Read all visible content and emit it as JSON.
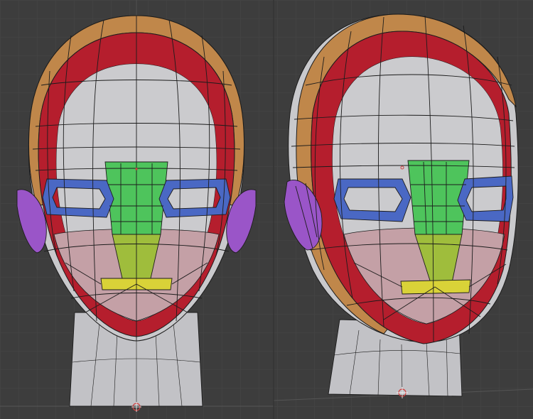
{
  "scene": {
    "views": [
      {
        "name": "front-view"
      },
      {
        "name": "three-quarter-view"
      }
    ],
    "colors": {
      "background": "#3d3d3d",
      "grid": "#4a4a4a",
      "grid_axis": "#5a5a5a",
      "mesh_base": "#c9c9cc",
      "mesh_shade": "#aeaeb2",
      "forehead_band_orange": "#c0874a",
      "face_loop_red": "#b51e2d",
      "eye_loop_blue": "#4a68c4",
      "nose_green": "#4ec45c",
      "nose_tip_yellowgreen": "#9fbd3c",
      "mouth_yellow": "#d9d238",
      "cheek_pink": "#c4a0a6",
      "ear_purple": "#9a55c8",
      "origin_marker": "#d04040"
    }
  }
}
